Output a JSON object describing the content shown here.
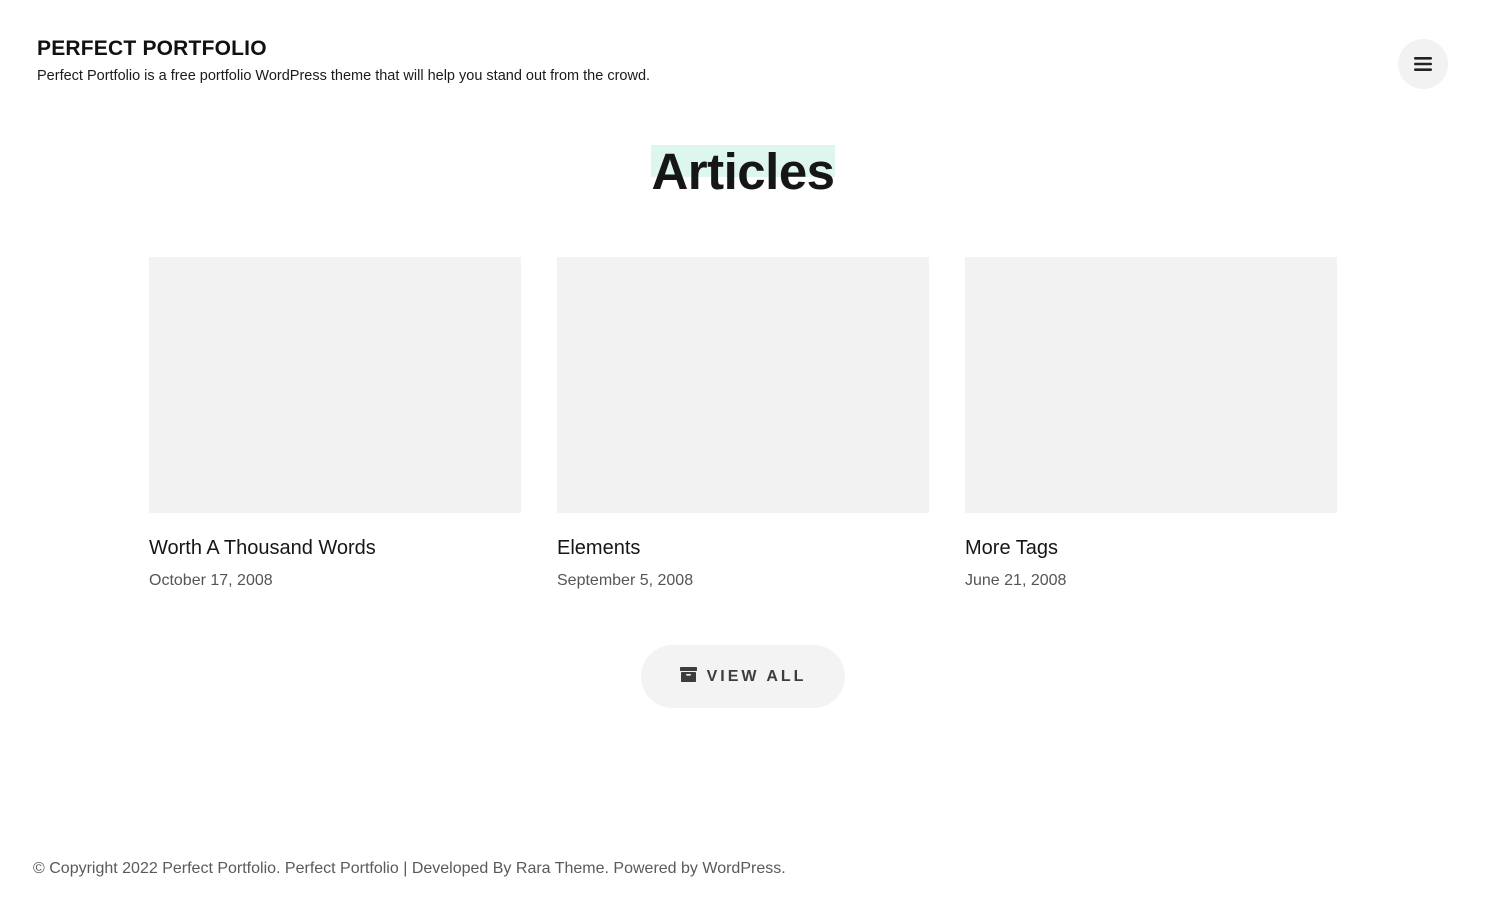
{
  "header": {
    "site_title": "PERFECT PORTFOLIO",
    "tagline": "Perfect Portfolio is a free portfolio WordPress theme that will help you stand out from the crowd.",
    "menu_icon": "hamburger-menu-icon"
  },
  "articles": {
    "title": "Articles",
    "highlight_color": "#ddf6ee",
    "items": [
      {
        "title": "Worth A Thousand Words",
        "date": "October 17, 2008"
      },
      {
        "title": "Elements",
        "date": "September 5, 2008"
      },
      {
        "title": "More Tags",
        "date": "June 21, 2008"
      }
    ],
    "view_all_label": "VIEW ALL",
    "view_all_icon": "archive-icon"
  },
  "footer": {
    "copyright": "© Copyright 2022 Perfect Portfolio.",
    "theme_name": "Perfect Portfolio",
    "separator": "|",
    "developed_by_prefix": "Developed By",
    "developer": "Rara Theme.",
    "powered_by_prefix": "Powered by",
    "platform": "WordPress."
  }
}
